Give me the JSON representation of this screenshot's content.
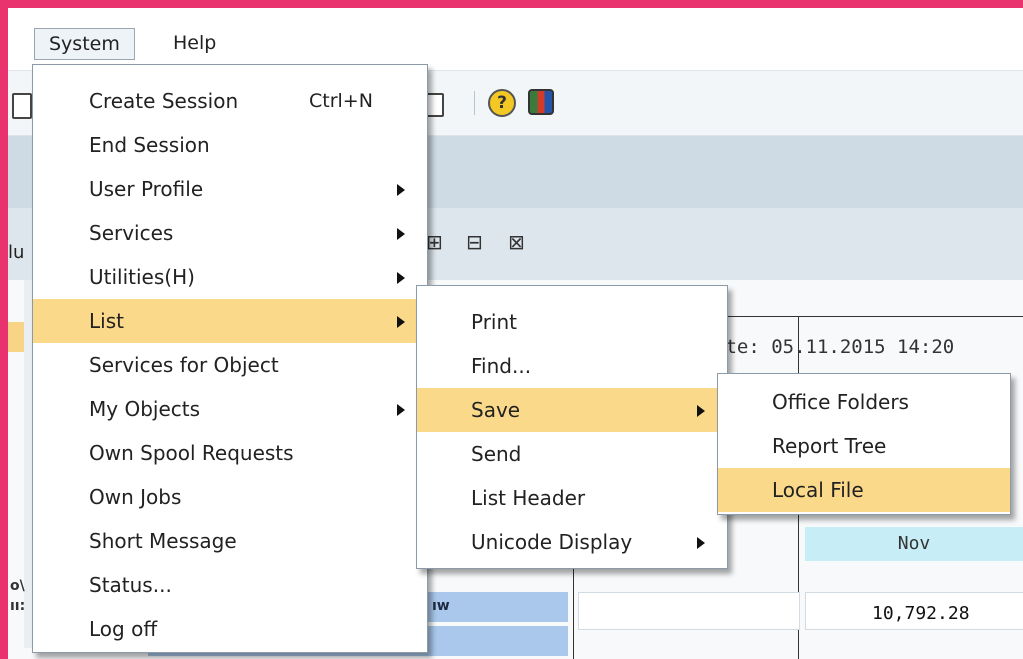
{
  "menubar": {
    "system_label": "System",
    "help_label": "Help"
  },
  "toolbar": {
    "icons": [
      "session-icon",
      "help-icon",
      "layout-icon"
    ]
  },
  "apptoolbar": {
    "left_fragment": "lu",
    "icons": [
      "tree-expand-icon",
      "tree-node-icon",
      "tree-collapse-icon"
    ]
  },
  "content": {
    "date_text": "ate:  05.11.2015 14:20",
    "column_header": "Nov",
    "amount": "10,792.28",
    "row_fragment": "ıw",
    "left_glyphs": [
      "o\\",
      "ıı:"
    ]
  },
  "system_menu": {
    "items": [
      {
        "label": "Create Session",
        "accel": "Ctrl+N",
        "submenu": false
      },
      {
        "label": "End Session",
        "accel": "",
        "submenu": false
      },
      {
        "label": "User Profile",
        "accel": "",
        "submenu": true
      },
      {
        "label": "Services",
        "accel": "",
        "submenu": true
      },
      {
        "label": "Utilities(H)",
        "accel": "",
        "submenu": true
      },
      {
        "label": "List",
        "accel": "",
        "submenu": true,
        "highlighted": true
      },
      {
        "label": "Services for Object",
        "accel": "",
        "submenu": false
      },
      {
        "label": "My Objects",
        "accel": "",
        "submenu": true
      },
      {
        "label": "Own Spool Requests",
        "accel": "",
        "submenu": false
      },
      {
        "label": "Own Jobs",
        "accel": "",
        "submenu": false
      },
      {
        "label": "Short Message",
        "accel": "",
        "submenu": false
      },
      {
        "label": "Status...",
        "accel": "",
        "submenu": false
      },
      {
        "label": "Log off",
        "accel": "",
        "submenu": false
      }
    ]
  },
  "list_menu": {
    "items": [
      {
        "label": "Print",
        "submenu": false
      },
      {
        "label": "Find...",
        "submenu": false
      },
      {
        "label": "Save",
        "submenu": true,
        "highlighted": true
      },
      {
        "label": "Send",
        "submenu": false
      },
      {
        "label": "List Header",
        "submenu": false
      },
      {
        "label": "Unicode Display",
        "submenu": true
      }
    ]
  },
  "save_menu": {
    "items": [
      {
        "label": "Office Folders"
      },
      {
        "label": "Report Tree"
      },
      {
        "label": "Local File",
        "highlighted": true
      }
    ]
  },
  "colors": {
    "frame": "#e8336f",
    "highlight": "#fbd98a",
    "row_blue": "#a9c8eb",
    "header_cyan": "#c7edf7"
  }
}
